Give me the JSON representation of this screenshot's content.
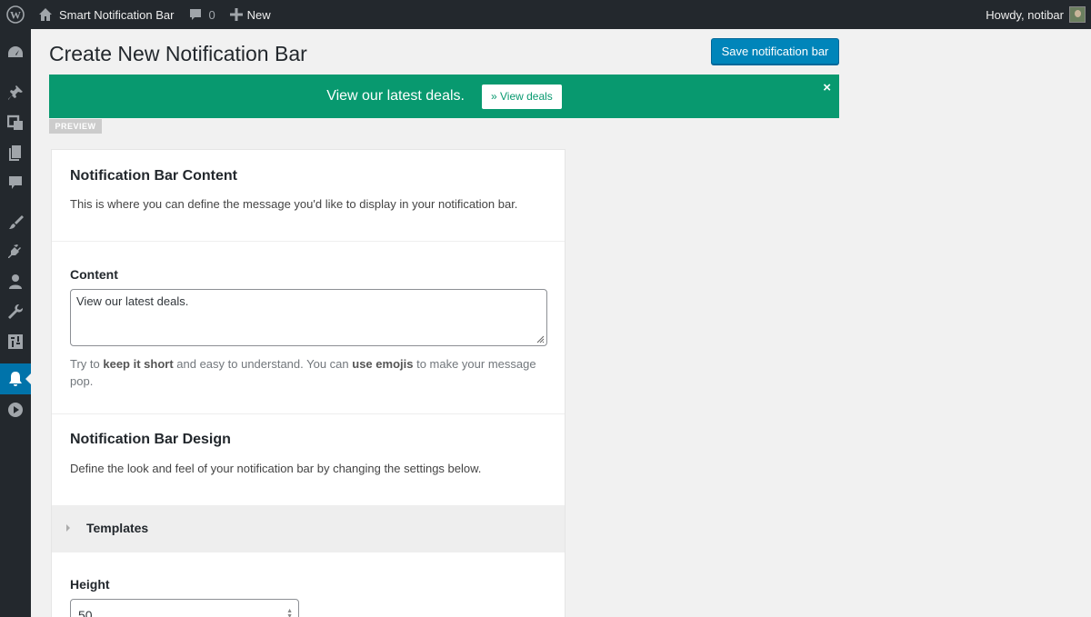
{
  "adminbar": {
    "site_name": "Smart Notification Bar",
    "comment_count": "0",
    "new_label": "New",
    "howdy": "Howdy, notibar"
  },
  "sidebar": {
    "items": [
      {
        "icon": "dashboard-icon"
      },
      {
        "icon": "pin-icon"
      },
      {
        "icon": "media-icon"
      },
      {
        "icon": "pages-icon"
      },
      {
        "icon": "comments-icon"
      },
      {
        "icon": "appearance-icon"
      },
      {
        "icon": "plugins-icon"
      },
      {
        "icon": "users-icon"
      },
      {
        "icon": "tools-icon"
      },
      {
        "icon": "settings-icon"
      },
      {
        "icon": "bell-icon",
        "active": true
      },
      {
        "icon": "play-icon"
      }
    ]
  },
  "page": {
    "title": "Create New Notification Bar",
    "save_label": "Save notification bar"
  },
  "preview": {
    "message": "View our latest deals.",
    "cta": "» View deals",
    "close": "×",
    "tag": "PREVIEW",
    "bg_color": "#08996f"
  },
  "content_section": {
    "title": "Notification Bar Content",
    "description": "This is where you can define the message you'd like to display in your notification bar.",
    "field_label": "Content",
    "field_value": "View our latest deals.",
    "help_pre": "Try to ",
    "help_b1": "keep it short",
    "help_mid": " and easy to understand. You can ",
    "help_b2": "use emojis",
    "help_post": " to make your message pop."
  },
  "design_section": {
    "title": "Notification Bar Design",
    "description": "Define the look and feel of your notification bar by changing the settings below.",
    "templates_label": "Templates",
    "height_label": "Height",
    "height_value": "50"
  },
  "colors": {
    "accent": "#0085ba",
    "admin_bar": "#23282d"
  }
}
